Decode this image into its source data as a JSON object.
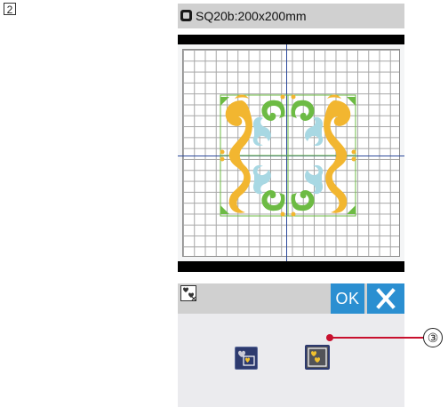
{
  "step": {
    "number": "2"
  },
  "hoop": {
    "label": "SQ20b:200x200mm"
  },
  "buttons": {
    "ok_label": "OK"
  },
  "callout": {
    "number": "③"
  },
  "colors": {
    "ok_button": "#2b8fd1",
    "design_orange": "#f2b630",
    "design_green": "#6dbb44",
    "design_light_blue": "#a8d8e3",
    "axis_blue": "#2c4a9c",
    "callout_red": "#c8102e"
  },
  "icons": {
    "hoop": "hoop-icon",
    "select": "select-design-icon",
    "close": "close-icon",
    "mode_a": "mode-single-icon",
    "mode_b": "mode-group-icon"
  }
}
